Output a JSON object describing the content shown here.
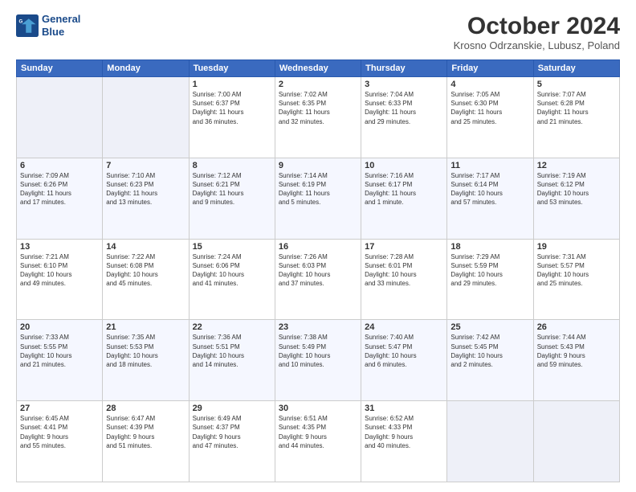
{
  "header": {
    "logo_line1": "General",
    "logo_line2": "Blue",
    "title": "October 2024",
    "subtitle": "Krosno Odrzanskie, Lubusz, Poland"
  },
  "weekdays": [
    "Sunday",
    "Monday",
    "Tuesday",
    "Wednesday",
    "Thursday",
    "Friday",
    "Saturday"
  ],
  "weeks": [
    [
      {
        "day": "",
        "info": ""
      },
      {
        "day": "",
        "info": ""
      },
      {
        "day": "1",
        "info": "Sunrise: 7:00 AM\nSunset: 6:37 PM\nDaylight: 11 hours\nand 36 minutes."
      },
      {
        "day": "2",
        "info": "Sunrise: 7:02 AM\nSunset: 6:35 PM\nDaylight: 11 hours\nand 32 minutes."
      },
      {
        "day": "3",
        "info": "Sunrise: 7:04 AM\nSunset: 6:33 PM\nDaylight: 11 hours\nand 29 minutes."
      },
      {
        "day": "4",
        "info": "Sunrise: 7:05 AM\nSunset: 6:30 PM\nDaylight: 11 hours\nand 25 minutes."
      },
      {
        "day": "5",
        "info": "Sunrise: 7:07 AM\nSunset: 6:28 PM\nDaylight: 11 hours\nand 21 minutes."
      }
    ],
    [
      {
        "day": "6",
        "info": "Sunrise: 7:09 AM\nSunset: 6:26 PM\nDaylight: 11 hours\nand 17 minutes."
      },
      {
        "day": "7",
        "info": "Sunrise: 7:10 AM\nSunset: 6:23 PM\nDaylight: 11 hours\nand 13 minutes."
      },
      {
        "day": "8",
        "info": "Sunrise: 7:12 AM\nSunset: 6:21 PM\nDaylight: 11 hours\nand 9 minutes."
      },
      {
        "day": "9",
        "info": "Sunrise: 7:14 AM\nSunset: 6:19 PM\nDaylight: 11 hours\nand 5 minutes."
      },
      {
        "day": "10",
        "info": "Sunrise: 7:16 AM\nSunset: 6:17 PM\nDaylight: 11 hours\nand 1 minute."
      },
      {
        "day": "11",
        "info": "Sunrise: 7:17 AM\nSunset: 6:14 PM\nDaylight: 10 hours\nand 57 minutes."
      },
      {
        "day": "12",
        "info": "Sunrise: 7:19 AM\nSunset: 6:12 PM\nDaylight: 10 hours\nand 53 minutes."
      }
    ],
    [
      {
        "day": "13",
        "info": "Sunrise: 7:21 AM\nSunset: 6:10 PM\nDaylight: 10 hours\nand 49 minutes."
      },
      {
        "day": "14",
        "info": "Sunrise: 7:22 AM\nSunset: 6:08 PM\nDaylight: 10 hours\nand 45 minutes."
      },
      {
        "day": "15",
        "info": "Sunrise: 7:24 AM\nSunset: 6:06 PM\nDaylight: 10 hours\nand 41 minutes."
      },
      {
        "day": "16",
        "info": "Sunrise: 7:26 AM\nSunset: 6:03 PM\nDaylight: 10 hours\nand 37 minutes."
      },
      {
        "day": "17",
        "info": "Sunrise: 7:28 AM\nSunset: 6:01 PM\nDaylight: 10 hours\nand 33 minutes."
      },
      {
        "day": "18",
        "info": "Sunrise: 7:29 AM\nSunset: 5:59 PM\nDaylight: 10 hours\nand 29 minutes."
      },
      {
        "day": "19",
        "info": "Sunrise: 7:31 AM\nSunset: 5:57 PM\nDaylight: 10 hours\nand 25 minutes."
      }
    ],
    [
      {
        "day": "20",
        "info": "Sunrise: 7:33 AM\nSunset: 5:55 PM\nDaylight: 10 hours\nand 21 minutes."
      },
      {
        "day": "21",
        "info": "Sunrise: 7:35 AM\nSunset: 5:53 PM\nDaylight: 10 hours\nand 18 minutes."
      },
      {
        "day": "22",
        "info": "Sunrise: 7:36 AM\nSunset: 5:51 PM\nDaylight: 10 hours\nand 14 minutes."
      },
      {
        "day": "23",
        "info": "Sunrise: 7:38 AM\nSunset: 5:49 PM\nDaylight: 10 hours\nand 10 minutes."
      },
      {
        "day": "24",
        "info": "Sunrise: 7:40 AM\nSunset: 5:47 PM\nDaylight: 10 hours\nand 6 minutes."
      },
      {
        "day": "25",
        "info": "Sunrise: 7:42 AM\nSunset: 5:45 PM\nDaylight: 10 hours\nand 2 minutes."
      },
      {
        "day": "26",
        "info": "Sunrise: 7:44 AM\nSunset: 5:43 PM\nDaylight: 9 hours\nand 59 minutes."
      }
    ],
    [
      {
        "day": "27",
        "info": "Sunrise: 6:45 AM\nSunset: 4:41 PM\nDaylight: 9 hours\nand 55 minutes."
      },
      {
        "day": "28",
        "info": "Sunrise: 6:47 AM\nSunset: 4:39 PM\nDaylight: 9 hours\nand 51 minutes."
      },
      {
        "day": "29",
        "info": "Sunrise: 6:49 AM\nSunset: 4:37 PM\nDaylight: 9 hours\nand 47 minutes."
      },
      {
        "day": "30",
        "info": "Sunrise: 6:51 AM\nSunset: 4:35 PM\nDaylight: 9 hours\nand 44 minutes."
      },
      {
        "day": "31",
        "info": "Sunrise: 6:52 AM\nSunset: 4:33 PM\nDaylight: 9 hours\nand 40 minutes."
      },
      {
        "day": "",
        "info": ""
      },
      {
        "day": "",
        "info": ""
      }
    ]
  ]
}
